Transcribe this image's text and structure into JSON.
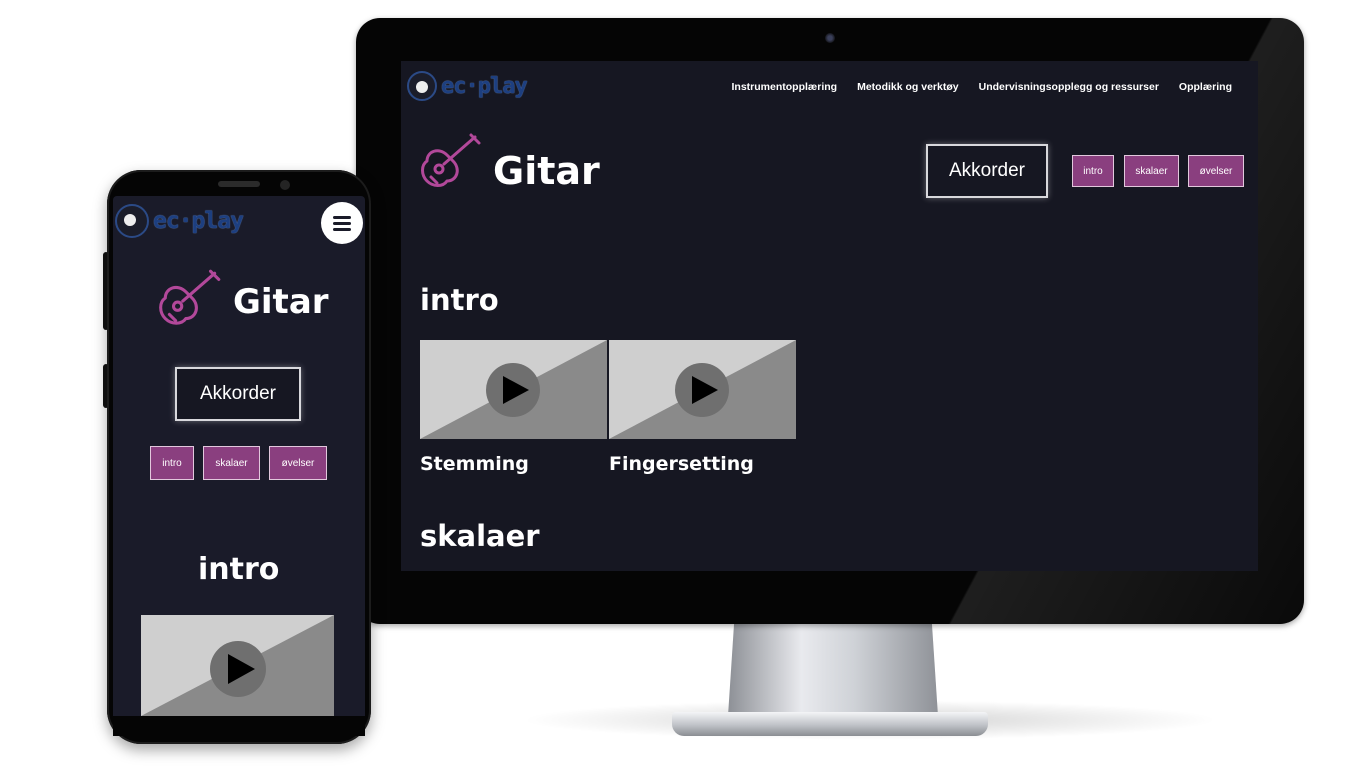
{
  "desktop": {
    "logo_text": "ec·play",
    "nav": [
      "Instrumentopplæring",
      "Metodikk og verktøy",
      "Undervisningsopplegg og ressurser",
      "Opplæring"
    ],
    "page_title": "Gitar",
    "main_button": "Akkorder",
    "chips": [
      "intro",
      "skalaer",
      "øvelser"
    ],
    "sections": [
      {
        "heading": "intro",
        "videos": [
          "Stemming",
          "Fingersetting"
        ]
      },
      {
        "heading": "skalaer",
        "videos": []
      }
    ]
  },
  "mobile": {
    "logo_text": "ec·play",
    "page_title": "Gitar",
    "main_button": "Akkorder",
    "chips": [
      "intro",
      "skalaer",
      "øvelser"
    ],
    "section_heading": "intro"
  },
  "colors": {
    "background": "#161722",
    "accent": "#8a3f7f",
    "guitar_icon": "#b2489a",
    "logo": "#1d3f80"
  },
  "icons": [
    "guitar-icon",
    "play-icon",
    "menu-icon",
    "logo-face-icon"
  ]
}
